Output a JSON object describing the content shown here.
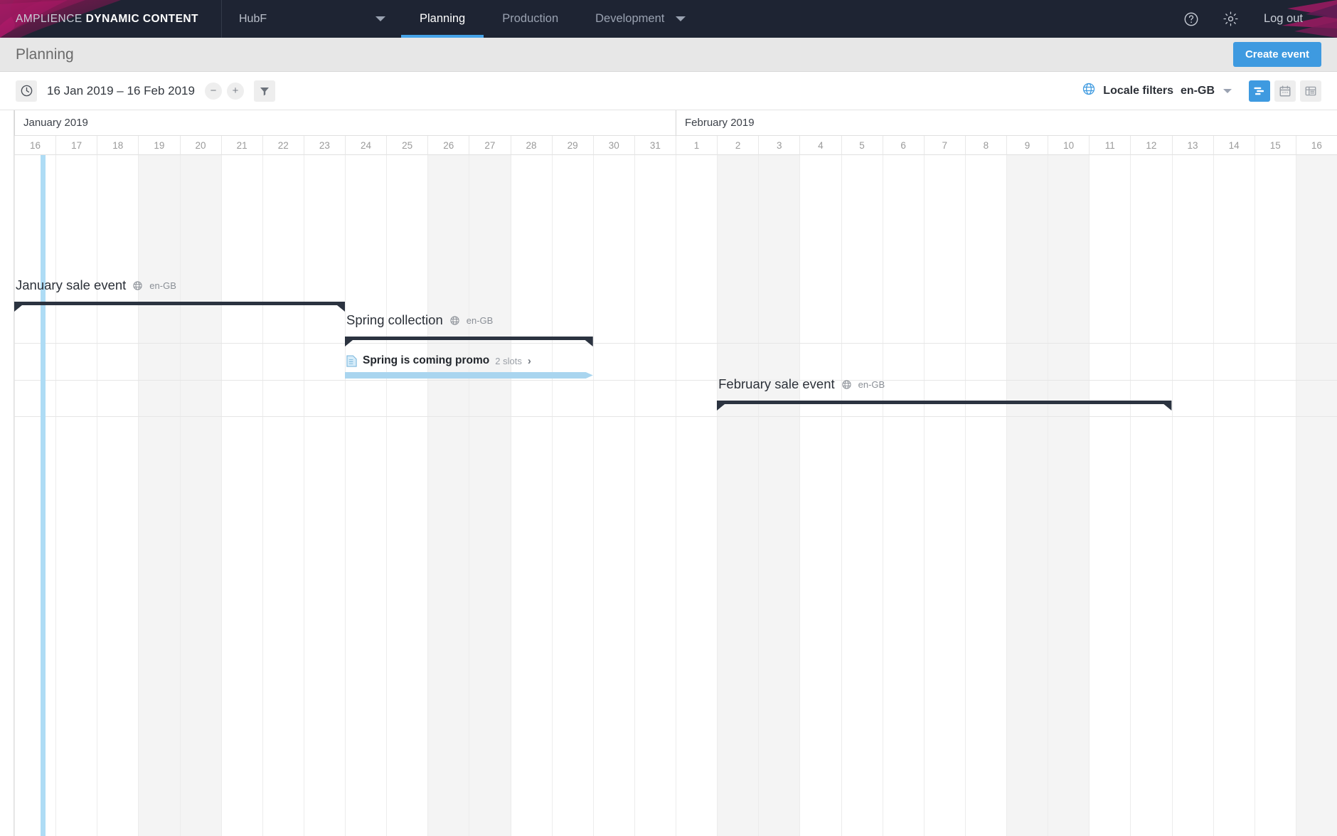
{
  "topnav": {
    "brand_light": "AMPLIENCE",
    "brand_bold": "DYNAMIC CONTENT",
    "hub_name": "HubF",
    "tabs": [
      {
        "label": "Planning",
        "active": true
      },
      {
        "label": "Production",
        "active": false
      },
      {
        "label": "Development",
        "active": false,
        "has_caret": true
      }
    ],
    "help_icon": "help-circle-icon",
    "settings_icon": "gear-icon",
    "logout_label": "Log out",
    "accent_color": "#45a3e8",
    "background_color": "#1e2433"
  },
  "pagehead": {
    "title": "Planning",
    "create_event_label": "Create event",
    "create_event_color": "#3e9ae0"
  },
  "toolbar": {
    "clock_icon": "clock-icon",
    "date_range": "16 Jan 2019 – 16 Feb 2019",
    "zoom_out_label": "−",
    "zoom_in_label": "+",
    "filter_icon": "funnel-icon",
    "globe_icon": "globe-icon",
    "locale_label": "Locale filters",
    "locale_value": "en-GB",
    "views": [
      {
        "name": "timeline-view",
        "icon": "timeline-icon",
        "active": true
      },
      {
        "name": "calendar-view",
        "icon": "calendar-icon",
        "active": false
      },
      {
        "name": "list-view",
        "icon": "list-icon",
        "active": false
      }
    ]
  },
  "timeline": {
    "months": [
      {
        "label": "January 2019",
        "start_day_index": 0,
        "day_count": 16
      },
      {
        "label": "February 2019",
        "start_day_index": 16,
        "day_count": 16
      }
    ],
    "days": [
      "16",
      "17",
      "18",
      "19",
      "20",
      "21",
      "22",
      "23",
      "24",
      "25",
      "26",
      "27",
      "28",
      "29",
      "30",
      "31",
      "1",
      "2",
      "3",
      "4",
      "5",
      "6",
      "7",
      "8",
      "9",
      "10",
      "11",
      "12",
      "13",
      "14",
      "15",
      "16"
    ],
    "weekend_day_indices": [
      3,
      4,
      10,
      11,
      17,
      18,
      24,
      25,
      31
    ],
    "now_day_index": 0,
    "row_separator_y": [
      327,
      379,
      430
    ],
    "events": [
      {
        "name": "January sale event",
        "locale": "en-GB",
        "locale_icon": "globe-icon",
        "start_day_index": 0,
        "end_day_index": 8,
        "bar_color": "#2b3340",
        "row": 0
      },
      {
        "name": "Spring collection",
        "locale": "en-GB",
        "locale_icon": "globe-icon",
        "start_day_index": 8,
        "end_day_index": 14,
        "bar_color": "#2b3340",
        "row": 1
      },
      {
        "name": "February sale event",
        "locale": "en-GB",
        "locale_icon": "globe-icon",
        "start_day_index": 17,
        "end_day_index": 28,
        "bar_color": "#2b3340",
        "row": 2
      }
    ],
    "slots": [
      {
        "name": "Spring is coming promo",
        "count_label": "2 slots",
        "doc_icon": "document-icon",
        "chevron_icon": "chevron-right-icon",
        "start_day_index": 8,
        "end_day_index": 14,
        "bar_color": "#a9d5ef",
        "parent_event": "Spring collection"
      }
    ]
  }
}
